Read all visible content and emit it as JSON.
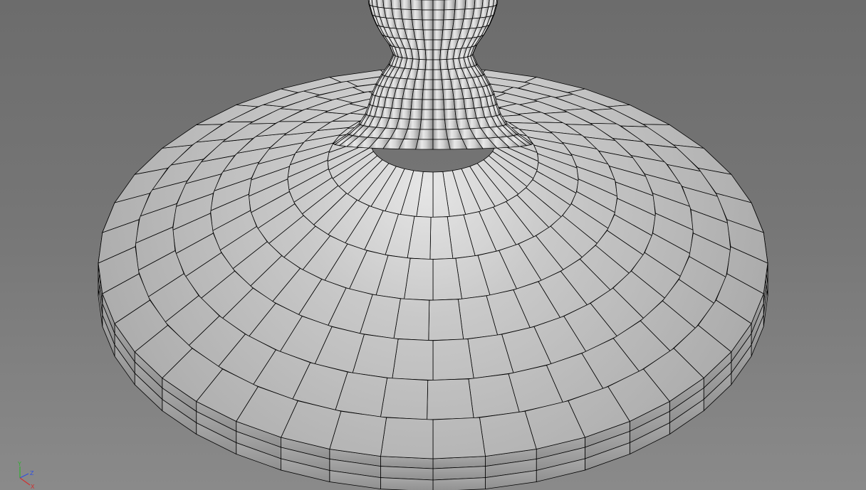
{
  "viewport": {
    "background_top": "#6c6c6c",
    "background_bottom": "#8a8a8a",
    "mesh_fill": "#b8b8b8",
    "wire_color": "#000000"
  },
  "axis_gizmo": {
    "x_label": "X",
    "y_label": "Y",
    "z_label": "Z",
    "x_color": "#d03030",
    "y_color": "#30b030",
    "z_color": "#3050e0"
  }
}
